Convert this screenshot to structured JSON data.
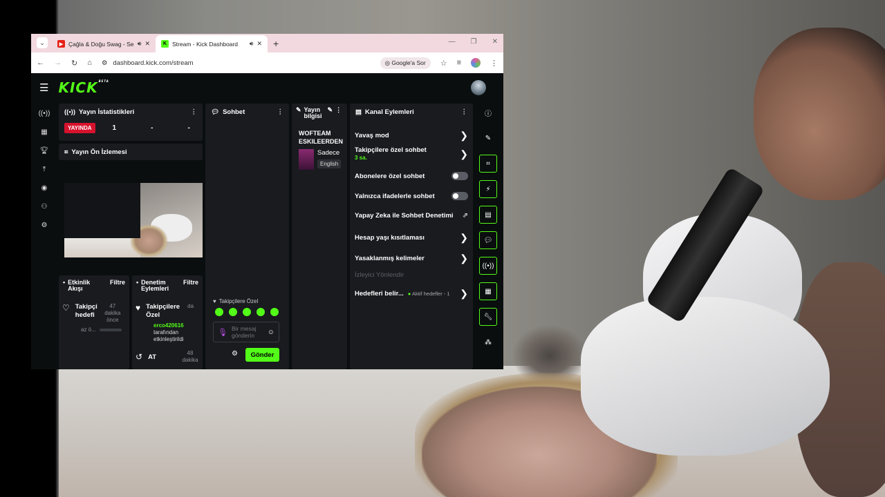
{
  "browser": {
    "tabs": [
      {
        "title": "Çağla & Doğu Swag - Seni",
        "active": false
      },
      {
        "title": "Stream - Kick Dashboard",
        "active": true
      }
    ],
    "url": "dashboard.kick.com/stream",
    "google_ask": "Google'a Sor"
  },
  "app": {
    "logo": "KICK",
    "beta": "BETA"
  },
  "stats": {
    "title": "Yayın İstatistikleri",
    "live_badge": "YAYINDA",
    "viewers": "1",
    "v2": "-",
    "v3": "-"
  },
  "preview": {
    "title": "Yayın Ön İzlemesi"
  },
  "activity": {
    "title": "Etkinlik Akışı",
    "filter": "Filtre",
    "item_title": "Takipçi hedefi",
    "item_time": "47 dakika önce",
    "item_sub": "az ö..."
  },
  "mod_actions": {
    "title": "Denetim Eylemleri",
    "filter": "Filtre",
    "item_title": "Takipçilere Özel",
    "item_time_short": "da",
    "item_user": "erco420616",
    "item_desc": "tarafından etkinleştirildi",
    "item2_title": "AT",
    "item2_time": "48 dakika"
  },
  "chat": {
    "title": "Sohbet",
    "followers_only": "Takipçilere Özel",
    "placeholder": "Bir mesaj gönderin",
    "send": "Gönder"
  },
  "stream_info": {
    "title": "Yayın bilgisi",
    "stream_title": "WOFTEAM ESKILEERDEN",
    "category": "Sadece",
    "language": "English"
  },
  "channel_actions": {
    "title": "Kanal Eylemleri",
    "slow_mode": "Yavaş mod",
    "followers_chat": "Takipçilere özel sohbet",
    "followers_chat_value": "3 sa.",
    "subs_chat": "Abonelere özel sohbet",
    "emotes_chat": "Yalnızca ifadelerle sohbet",
    "ai_moderation": "Yapay Zeka ile Sohbet Denetimi",
    "age_restriction": "Hesap yaşı kısıtlaması",
    "banned_words": "Yasaklanmış kelimeler",
    "viewer_redirect": "İzleyici Yönlendir",
    "goals": "Hedefleri belir...",
    "goals_status": "Aktif hedefler - 1"
  },
  "colors": {
    "accent": "#53fc18",
    "live": "#d7122d",
    "panel": "#191b1f"
  }
}
